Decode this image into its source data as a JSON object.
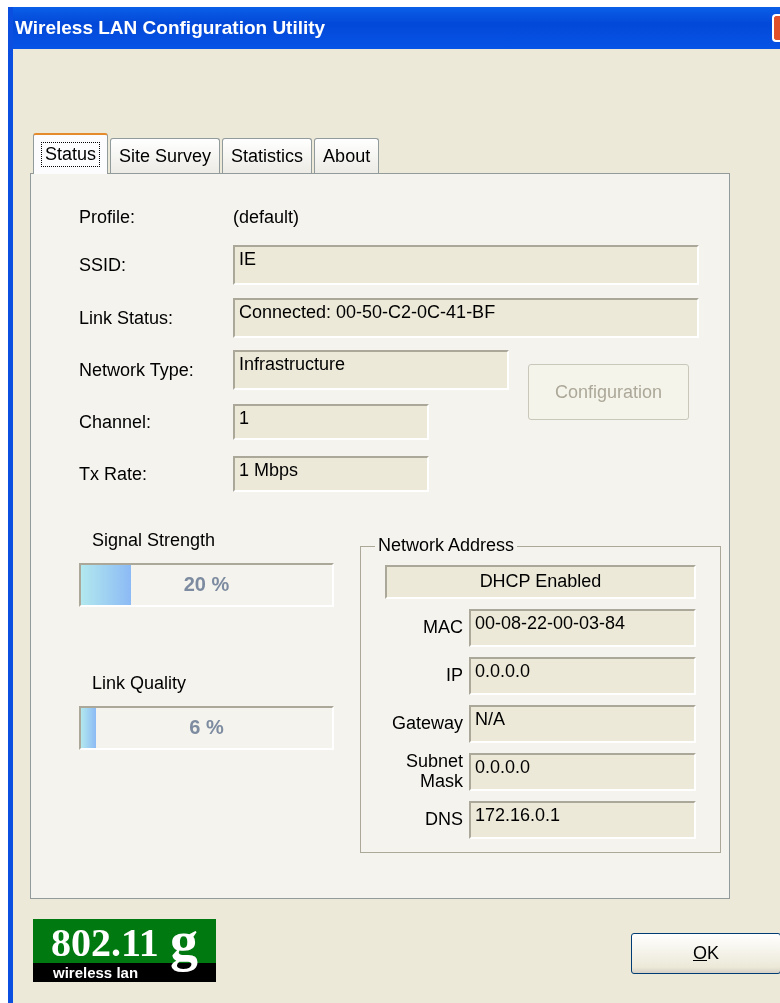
{
  "window": {
    "title": "Wireless LAN Configuration Utility"
  },
  "tabs": [
    {
      "label": "Status",
      "selected": true
    },
    {
      "label": "Site Survey",
      "selected": false
    },
    {
      "label": "Statistics",
      "selected": false
    },
    {
      "label": "About",
      "selected": false
    }
  ],
  "status": {
    "profile": {
      "label": "Profile:",
      "value": "(default)"
    },
    "fields": [
      {
        "label": "SSID:",
        "value": "IE",
        "kind": "long"
      },
      {
        "label": "Link Status:",
        "value": "Connected: 00-50-C2-0C-41-BF",
        "kind": "long"
      },
      {
        "label": "Network Type:",
        "value": "Infrastructure",
        "kind": "medium"
      },
      {
        "label": "Channel:",
        "value": "1",
        "kind": "short"
      },
      {
        "label": "Tx Rate:",
        "value": "1 Mbps",
        "kind": "short"
      }
    ],
    "configuration_button": {
      "label": "Configuration",
      "disabled": true
    }
  },
  "meters": [
    {
      "label": "Signal Strength",
      "level": 0.2,
      "reading": "20 %"
    },
    {
      "label": "Link Quality",
      "level": 0.06,
      "reading": "6 %"
    }
  ],
  "network_address": {
    "title": "Network Address",
    "dhcp": "DHCP Enabled",
    "rows": [
      {
        "label": "MAC",
        "value": "00-08-22-00-03-84"
      },
      {
        "label": "IP",
        "value": "0.0.0.0"
      },
      {
        "label": "Gateway",
        "value": "N/A"
      },
      {
        "label": "Subnet Mask",
        "value": "0.0.0.0"
      },
      {
        "label": "DNS",
        "value": "172.16.0.1"
      }
    ]
  },
  "logo": {
    "main": "802.11",
    "letter": "g",
    "sub": "wireless lan"
  },
  "buttons": [
    {
      "label": "OK",
      "disabled": false
    }
  ]
}
